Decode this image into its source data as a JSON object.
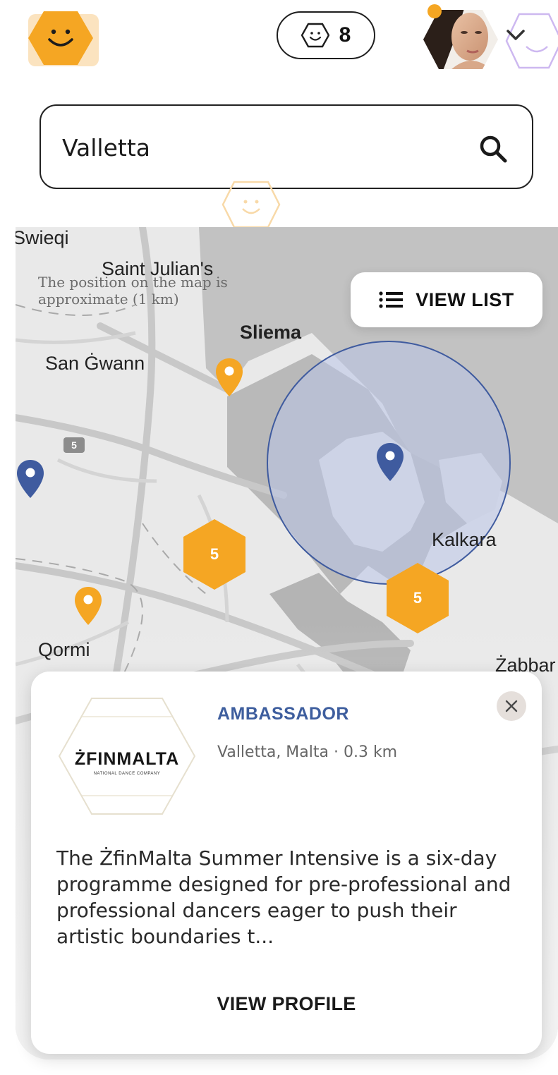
{
  "header": {
    "counter_value": "8",
    "logo_icon": "smiley-hexagon-icon",
    "avatar_icon": "user-avatar",
    "colors": {
      "brand_orange": "#f5a623",
      "accent_blue": "#3e5e9e"
    }
  },
  "search": {
    "value": "Valletta",
    "icon": "search-icon"
  },
  "map": {
    "labels": {
      "swieqi": "Swieqi",
      "saint_julians": "Saint Julian's",
      "sliema": "Sliema",
      "san_gwann": "San Ġwann",
      "kalkara": "Kalkara",
      "qormi": "Qormi",
      "zabbar": "Żabbar",
      "road_5": "5"
    },
    "approx_note": "The position on the map is approximate (1 km)",
    "view_list_label": "VIEW LIST",
    "clusters": [
      {
        "count": "5"
      },
      {
        "count": "5"
      }
    ]
  },
  "card": {
    "tag": "AMBASSADOR",
    "location": "Valletta, Malta · 0.3 km",
    "logo_text": "ŻFINMALTA",
    "logo_subtext": "NATIONAL DANCE COMPANY",
    "description": "The ŻfinMalta Summer Intensive is a six-day programme designed for pre-professional and professional dancers eager to push their artistic boundaries t...",
    "action_label": "VIEW PROFILE"
  }
}
